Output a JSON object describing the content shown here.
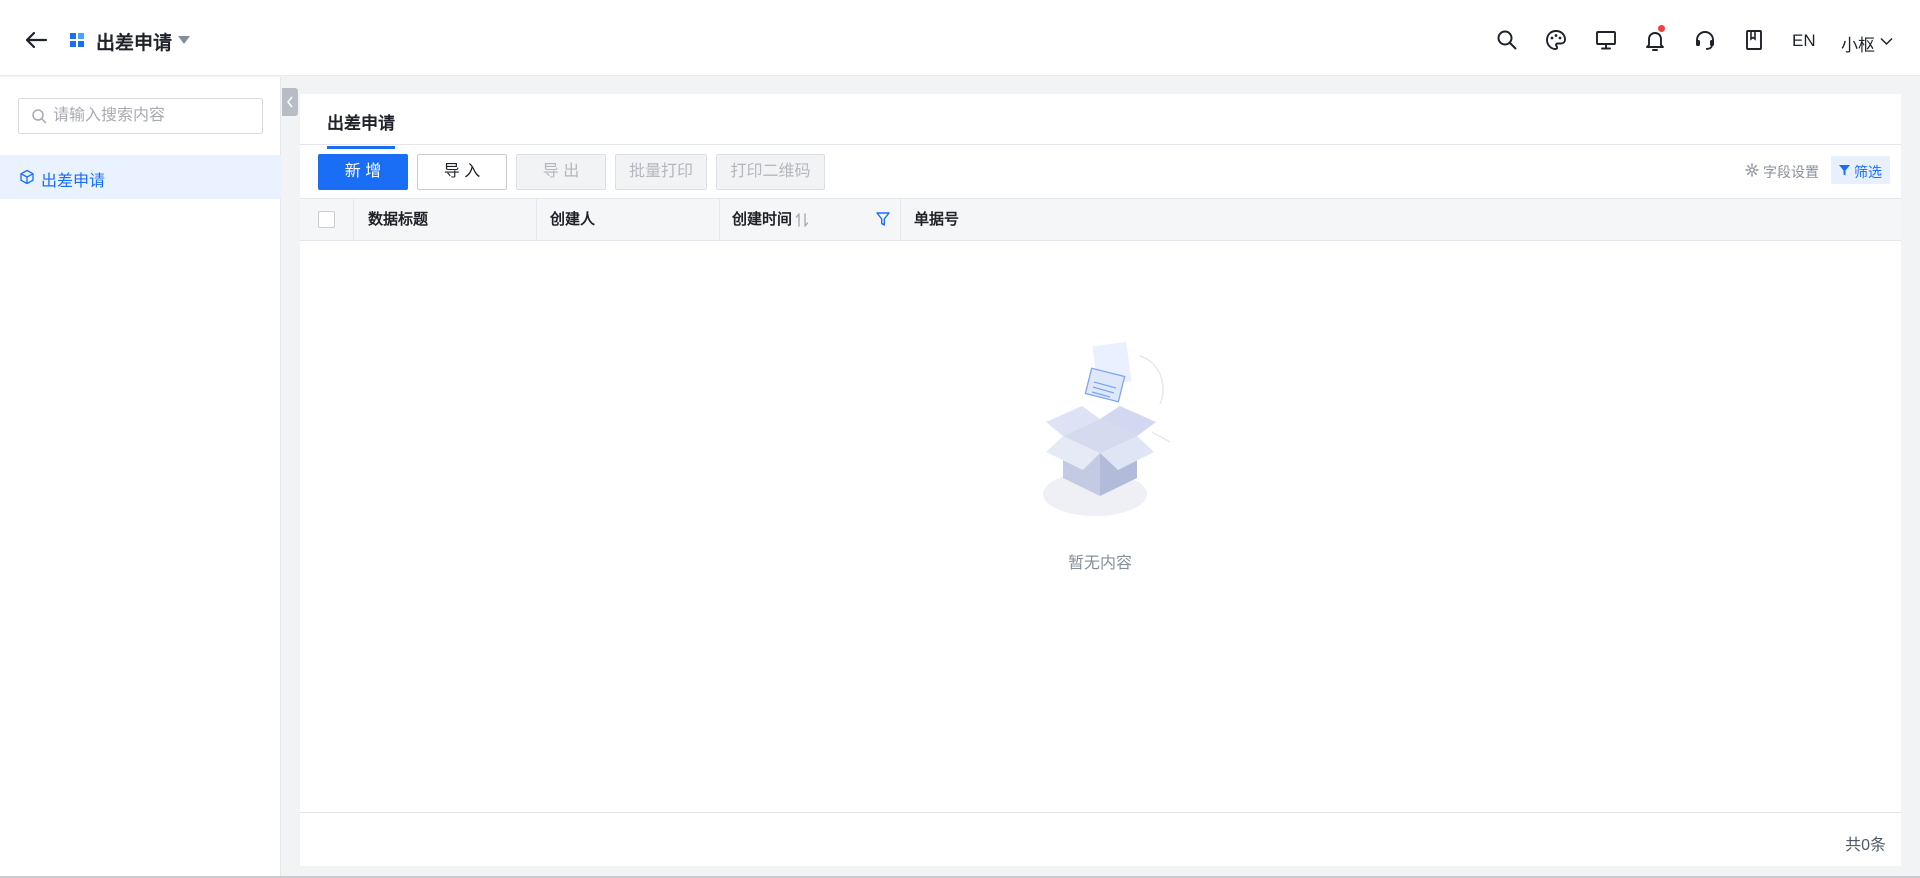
{
  "header": {
    "app_title": "出差申请",
    "lang_label": "EN",
    "user_name": "小枢",
    "icons": [
      "back-arrow-icon",
      "app-grid-icon",
      "search-icon",
      "palette-icon",
      "monitor-icon",
      "bell-icon",
      "headset-icon",
      "book-icon"
    ],
    "notification_dot_color": "#f53f3f"
  },
  "sidebar": {
    "search_placeholder": "请输入搜索内容",
    "items": [
      {
        "label": "出差申请",
        "icon": "cube-icon",
        "active": true
      }
    ]
  },
  "main": {
    "tabs": [
      {
        "label": "出差申请",
        "active": true
      }
    ],
    "toolbar": {
      "add_label": "新 增",
      "import_label": "导 入",
      "export_label": "导 出",
      "batch_print_label": "批量打印",
      "print_qr_label": "打印二维码",
      "field_settings_label": "字段设置",
      "filter_label": "筛选"
    },
    "table": {
      "columns": [
        "数据标题",
        "创建人",
        "创建时间",
        "单据号"
      ],
      "rows": []
    },
    "empty_text": "暂无内容",
    "footer_total": "共0条"
  },
  "colors": {
    "accent": "#1a6ef5",
    "active_bg": "#eaf2ff",
    "disabled_text": "#b4b7bd"
  }
}
